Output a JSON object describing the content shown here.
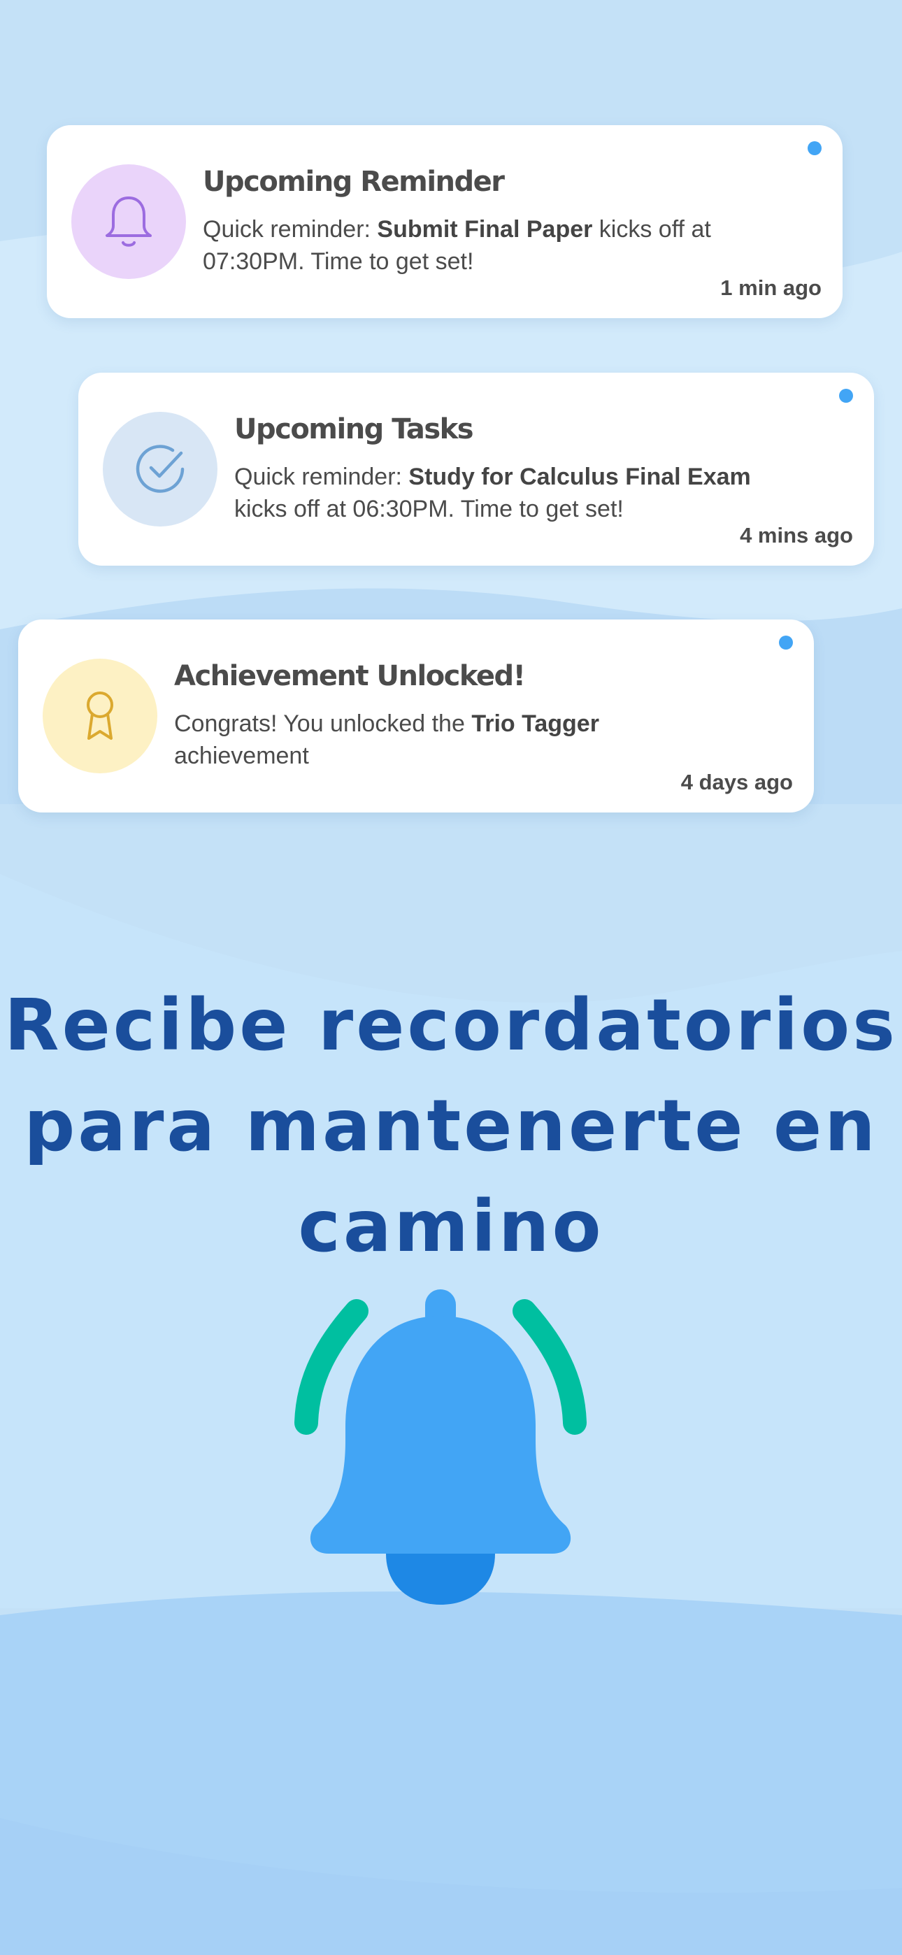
{
  "notifications": [
    {
      "title": "Upcoming Reminder",
      "message_prefix": "Quick reminder: ",
      "message_bold": "Submit Final Paper",
      "message_suffix": " kicks off at 07:30PM. Time to get set!",
      "time": "1 min ago",
      "icon": "bell-icon",
      "icon_bg": "#ead4fa",
      "icon_color": "#9c6ce0",
      "unread": true
    },
    {
      "title": "Upcoming Tasks",
      "message_prefix": "Quick reminder: ",
      "message_bold": "Study for Calculus Final Exam",
      "message_suffix": " kicks off at 06:30PM. Time to get set!",
      "time": "4 mins ago",
      "icon": "check-circle-icon",
      "icon_bg": "#d8e6f5",
      "icon_color": "#6da2d4",
      "unread": true
    },
    {
      "title": "Achievement Unlocked!",
      "message_prefix": "Congrats! You unlocked the ",
      "message_bold": "Trio Tagger",
      "message_suffix": " achievement",
      "time": "4 days ago",
      "icon": "award-ribbon-icon",
      "icon_bg": "#fdf1c4",
      "icon_color": "#dba92f",
      "unread": true
    }
  ],
  "headline": {
    "line1": "Recibe recordatorios",
    "line2": "para mantenerte en",
    "line3": "camino"
  },
  "illustration": {
    "icon": "ringing-bell-icon",
    "bell_color": "#42a5f5",
    "clapper_color": "#1e88e5",
    "ring_color": "#00bfa0"
  },
  "colors": {
    "background": "#c4e1f7",
    "headline": "#1a4e9c",
    "unread_dot": "#42a5f5"
  }
}
